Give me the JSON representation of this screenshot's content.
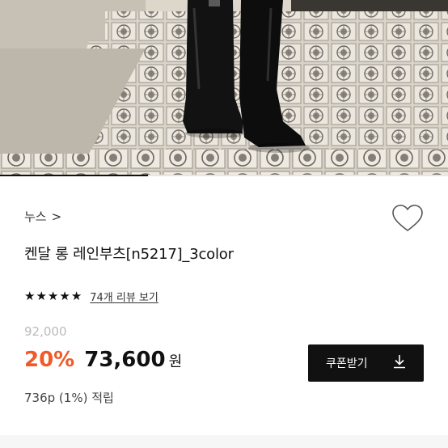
{
  "gallery": {
    "progress": 0.33
  },
  "brand": {
    "name": "누스",
    "chevron": ">"
  },
  "product": {
    "title": "켄달 롱 레인부츠[n5217]_3color"
  },
  "rating": {
    "stars": [
      "★",
      "★",
      "★",
      "★",
      "★"
    ],
    "review_link": "74개 리뷰 보기"
  },
  "pricing": {
    "original": "92,000",
    "discount": "20%",
    "price": "73,600",
    "currency": "원",
    "points": "736p (1%) 적립"
  },
  "coupon": {
    "label": "쿠폰받기"
  },
  "colors": {
    "discount": "#f05a28",
    "button": "#111111"
  }
}
